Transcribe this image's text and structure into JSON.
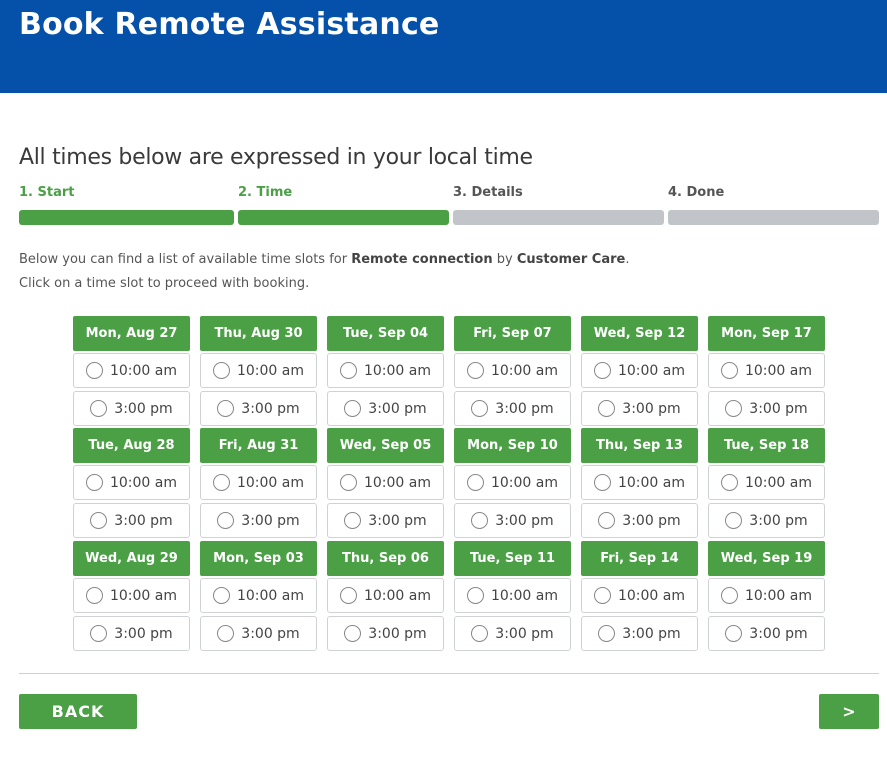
{
  "header": {
    "title": "Book Remote Assistance"
  },
  "subtitle": "All times below are expressed in your local time",
  "steps": [
    {
      "label": "1. Start",
      "active": true
    },
    {
      "label": "2. Time",
      "active": true
    },
    {
      "label": "3. Details",
      "active": false
    },
    {
      "label": "4. Done",
      "active": false
    }
  ],
  "intro": {
    "line1_prefix": "Below you can find a list of available time slots for ",
    "service": "Remote connection",
    "line1_mid": " by ",
    "team": "Customer Care",
    "line1_suffix": ".",
    "line2": "Click on a time slot to proceed with booking."
  },
  "days": [
    [
      {
        "label": "Mon, Aug 27",
        "slots": [
          "10:00 am",
          "3:00 pm"
        ]
      },
      {
        "label": "Tue, Aug 28",
        "slots": [
          "10:00 am",
          "3:00 pm"
        ]
      },
      {
        "label": "Wed, Aug 29",
        "slots": [
          "10:00 am",
          "3:00 pm"
        ]
      }
    ],
    [
      {
        "label": "Thu, Aug 30",
        "slots": [
          "10:00 am",
          "3:00 pm"
        ]
      },
      {
        "label": "Fri, Aug 31",
        "slots": [
          "10:00 am",
          "3:00 pm"
        ]
      },
      {
        "label": "Mon, Sep 03",
        "slots": [
          "10:00 am",
          "3:00 pm"
        ]
      }
    ],
    [
      {
        "label": "Tue, Sep 04",
        "slots": [
          "10:00 am",
          "3:00 pm"
        ]
      },
      {
        "label": "Wed, Sep 05",
        "slots": [
          "10:00 am",
          "3:00 pm"
        ]
      },
      {
        "label": "Thu, Sep 06",
        "slots": [
          "10:00 am",
          "3:00 pm"
        ]
      }
    ],
    [
      {
        "label": "Fri, Sep 07",
        "slots": [
          "10:00 am",
          "3:00 pm"
        ]
      },
      {
        "label": "Mon, Sep 10",
        "slots": [
          "10:00 am",
          "3:00 pm"
        ]
      },
      {
        "label": "Tue, Sep 11",
        "slots": [
          "10:00 am",
          "3:00 pm"
        ]
      }
    ],
    [
      {
        "label": "Wed, Sep 12",
        "slots": [
          "10:00 am",
          "3:00 pm"
        ]
      },
      {
        "label": "Thu, Sep 13",
        "slots": [
          "10:00 am",
          "3:00 pm"
        ]
      },
      {
        "label": "Fri, Sep 14",
        "slots": [
          "10:00 am",
          "3:00 pm"
        ]
      }
    ],
    [
      {
        "label": "Mon, Sep 17",
        "slots": [
          "10:00 am",
          "3:00 pm"
        ]
      },
      {
        "label": "Tue, Sep 18",
        "slots": [
          "10:00 am",
          "3:00 pm"
        ]
      },
      {
        "label": "Wed, Sep 19",
        "slots": [
          "10:00 am",
          "3:00 pm"
        ]
      }
    ]
  ],
  "buttons": {
    "back": "BACK",
    "next": ">"
  },
  "colors": {
    "header": "#0550a8",
    "accent": "#4ba046",
    "inactive_step": "#c1c5ca"
  }
}
